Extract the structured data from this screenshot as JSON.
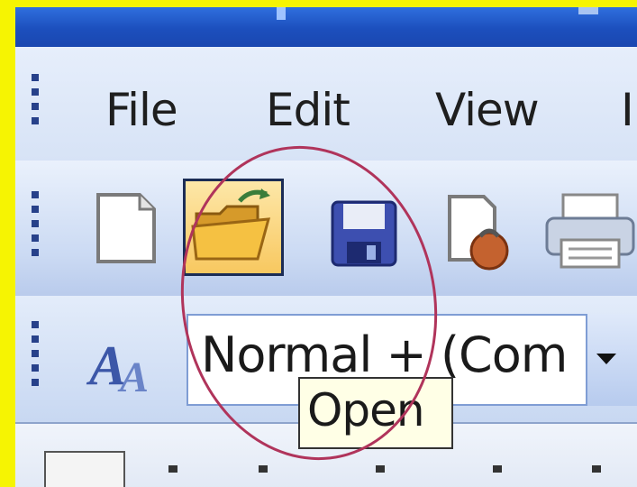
{
  "menubar": {
    "file": "File",
    "edit": "Edit",
    "view": "View",
    "next_partial": "I"
  },
  "toolbar": {
    "buttons": [
      {
        "name": "new-document",
        "icon": "blank-page-icon"
      },
      {
        "name": "open",
        "icon": "open-folder-icon",
        "hovered": true
      },
      {
        "name": "save",
        "icon": "floppy-disk-icon"
      },
      {
        "name": "permission",
        "icon": "document-lock-icon"
      },
      {
        "name": "print",
        "icon": "printer-icon"
      }
    ]
  },
  "formatting": {
    "styles_icon": "styles-aa-icon",
    "style_value": "Normal + (Com"
  },
  "tooltip": {
    "text": "Open"
  },
  "colors": {
    "border": "#f6f402",
    "titlebar": "#1c4fbd",
    "annotation": "#b0345b",
    "hover": "#f8c860"
  }
}
